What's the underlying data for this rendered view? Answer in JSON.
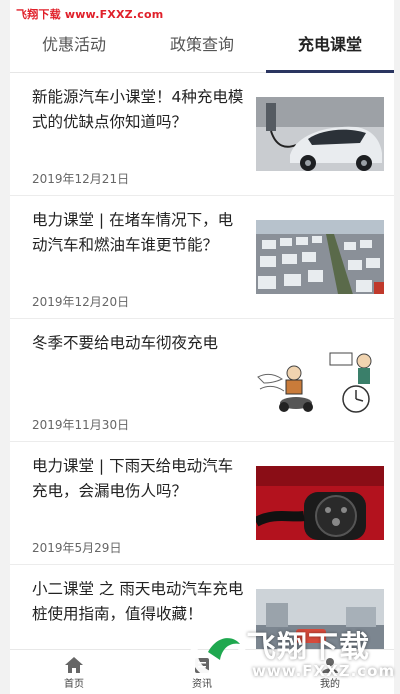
{
  "watermark_top": "飞翔下载 www.FXXZ.com",
  "tabs": [
    {
      "label": "优惠活动",
      "active": false
    },
    {
      "label": "政策查询",
      "active": false
    },
    {
      "label": "充电课堂",
      "active": true
    }
  ],
  "articles": [
    {
      "title": "新能源汽车小课堂！4种充电模式的优缺点你知道吗？",
      "date": "2019年12月21日",
      "image": "electric-car-charging"
    },
    {
      "title": "电力课堂 | 在堵车情况下，电动汽车和燃油车谁更节能？",
      "date": "2019年12月20日",
      "image": "traffic-jam"
    },
    {
      "title": "冬季不要给电动车彻夜充电",
      "date": "2019年11月30日",
      "image": "cartoon-scooter-clock"
    },
    {
      "title": "电力课堂 | 下雨天给电动汽车充电，会漏电伤人吗？",
      "date": "2019年5月29日",
      "image": "red-car-charging-port"
    },
    {
      "title": "小二课堂 之 雨天电动汽车充电桩使用指南，值得收藏！",
      "date": "",
      "image": "rainy-street"
    }
  ],
  "tabbar": [
    {
      "label": "首页",
      "icon": "home-icon"
    },
    {
      "label": "资讯",
      "icon": "news-icon"
    },
    {
      "label": "我的",
      "icon": "profile-icon"
    }
  ],
  "watermark_bottom": {
    "main": "飞翔下载",
    "sub": "www.FXXZ.com"
  },
  "colors": {
    "tab_indicator": "#2a3560",
    "watermark_red": "#e0202a",
    "watermark_green": "#1fa84f"
  }
}
